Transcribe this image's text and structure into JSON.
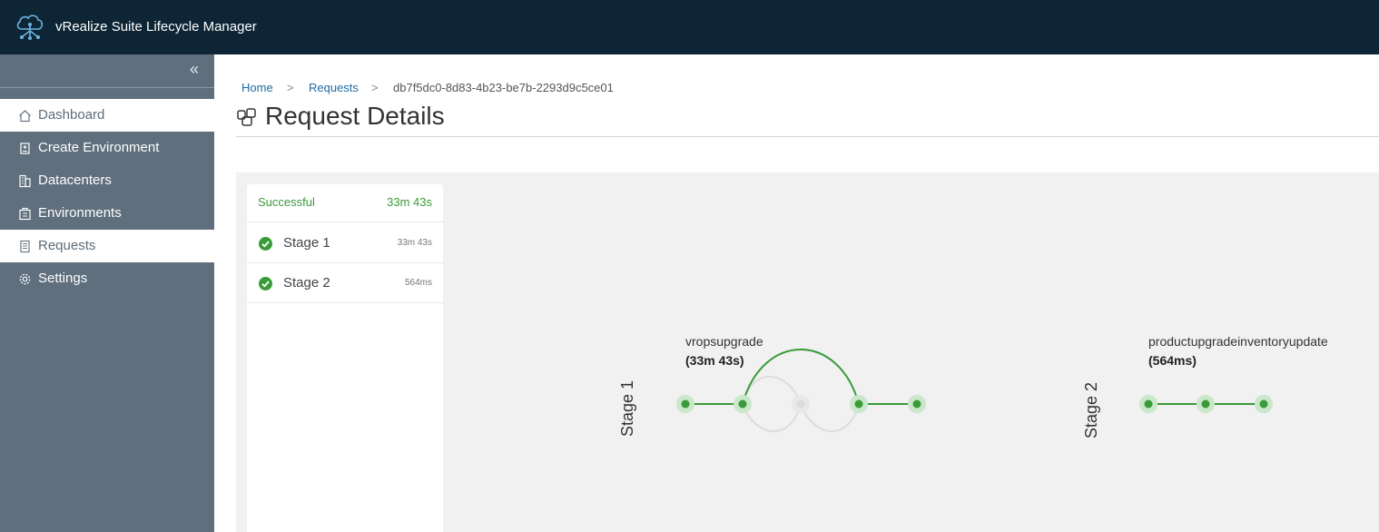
{
  "header": {
    "app_title": "vRealize Suite Lifecycle Manager",
    "logo_icon": "cloud-network-icon",
    "background": "#0d2535"
  },
  "sidebar": {
    "collapse_icon": "double-chevron-left-icon",
    "items": [
      {
        "label": "Dashboard",
        "icon": "home-icon",
        "active": true
      },
      {
        "label": "Create Environment",
        "icon": "create-env-icon",
        "active": false
      },
      {
        "label": "Datacenters",
        "icon": "building-icon",
        "active": false
      },
      {
        "label": "Environments",
        "icon": "environment-icon",
        "active": false
      },
      {
        "label": "Requests",
        "icon": "document-icon",
        "active": true
      },
      {
        "label": "Settings",
        "icon": "gear-icon",
        "active": false
      }
    ]
  },
  "breadcrumb": {
    "home": "Home",
    "requests": "Requests",
    "current": "db7f5dc0-8d83-4b23-be7b-2293d9c5ce01",
    "separator": ">"
  },
  "page": {
    "title": "Request Details",
    "title_icon": "request-details-icon"
  },
  "summary": {
    "status": "Successful",
    "total_time": "33m 43s",
    "stages": [
      {
        "label": "Stage 1",
        "time": "33m 43s",
        "state": "success"
      },
      {
        "label": "Stage 2",
        "time": "564ms",
        "state": "success"
      }
    ]
  },
  "pipeline": {
    "stages": [
      {
        "label": "Stage 1",
        "task": "vropsupgrade",
        "duration": "(33m 43s)"
      },
      {
        "label": "Stage 2",
        "task": "productupgradeinventoryupdate",
        "duration": "(564ms)"
      }
    ]
  },
  "colors": {
    "success": "#3a9a3a",
    "sidebar": "#5f6f7d",
    "link": "#1d6aa4",
    "canvas": "#f1f1f1"
  }
}
